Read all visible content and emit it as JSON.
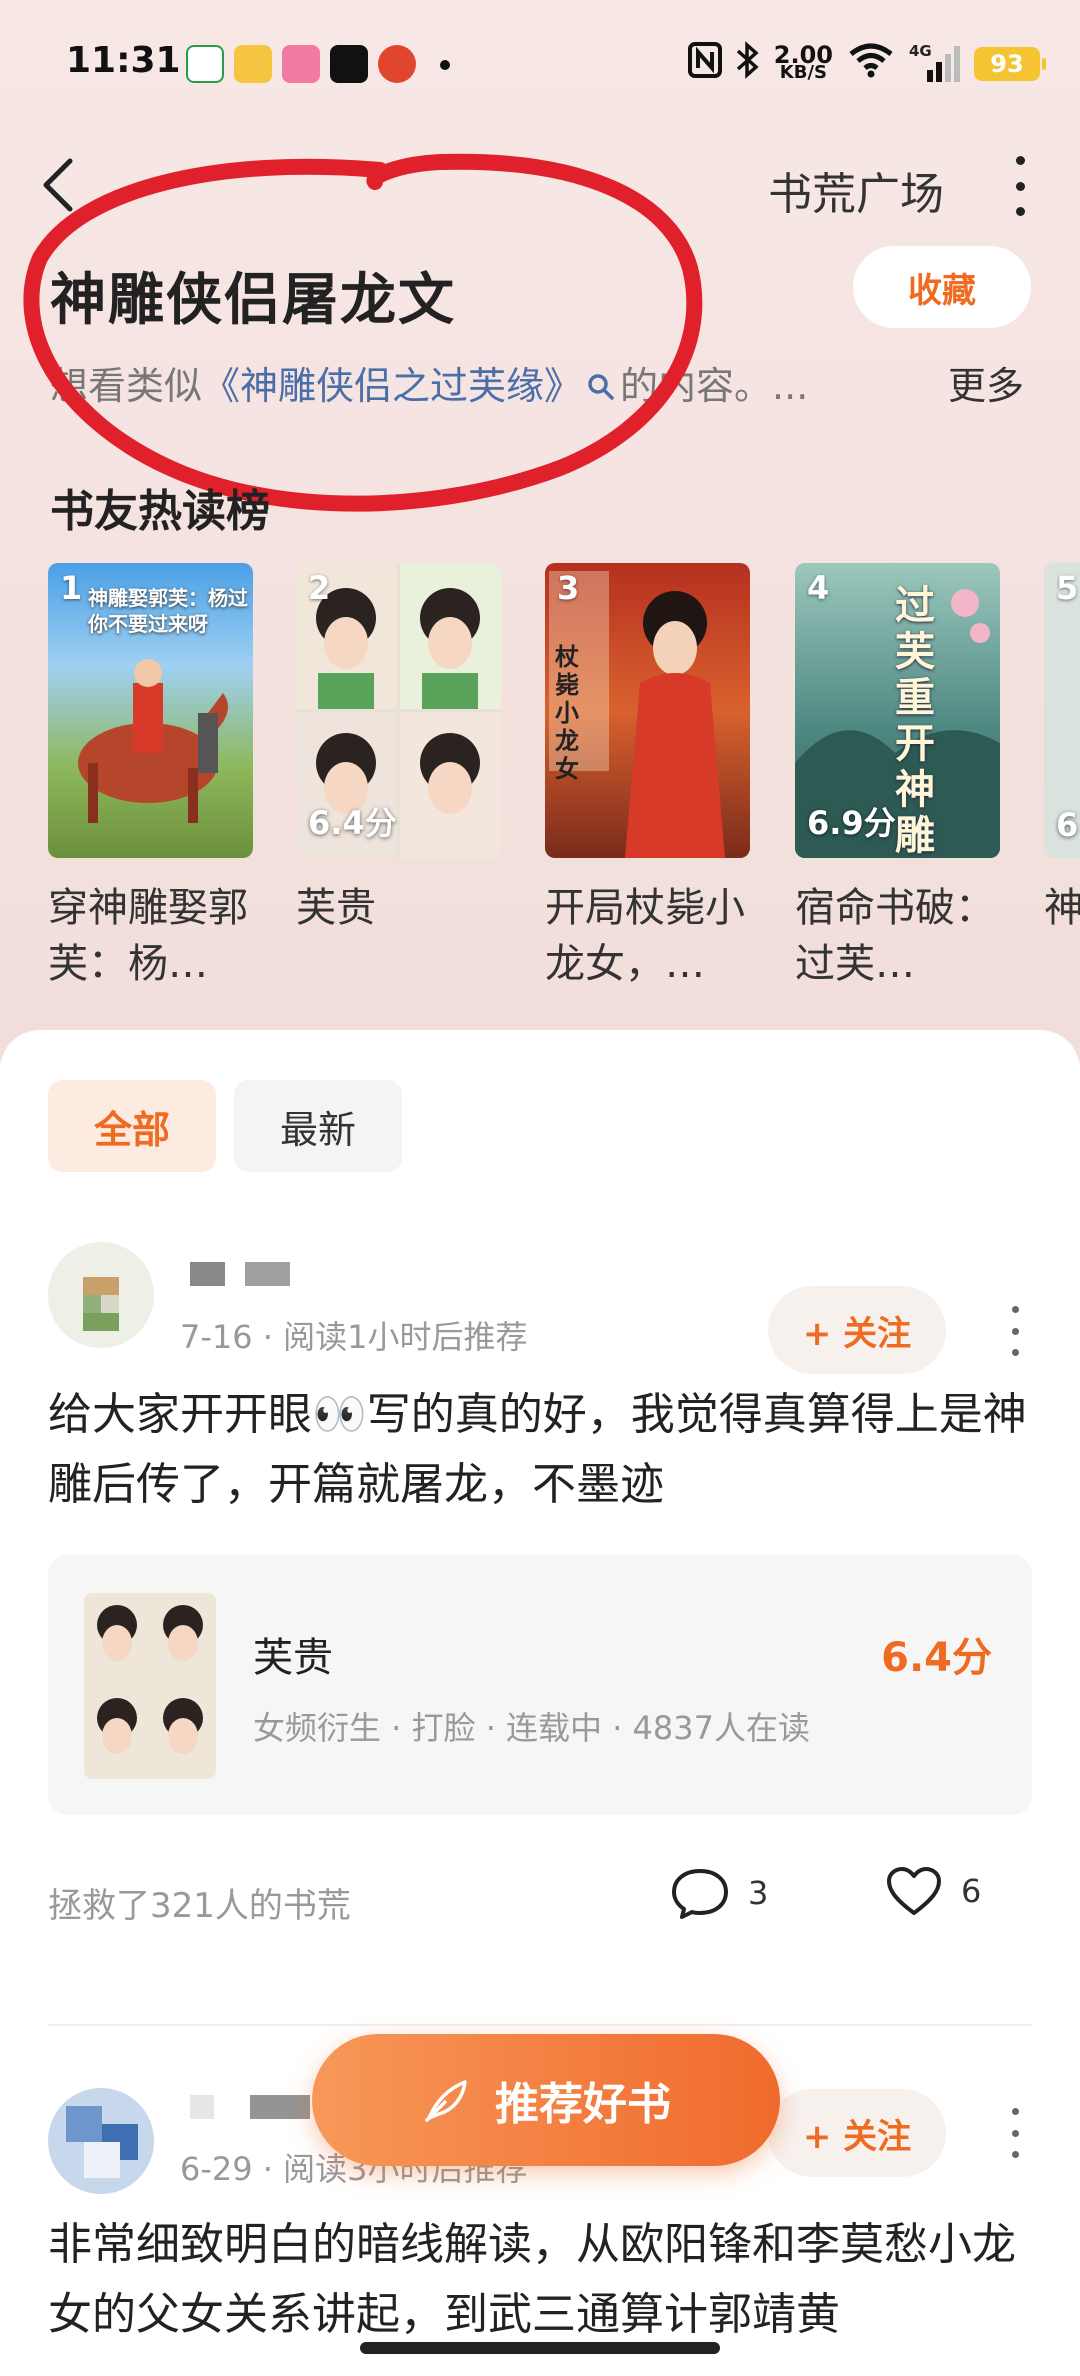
{
  "status_bar": {
    "time": "11:31",
    "net_speed_value": "2.00",
    "net_speed_unit": "KB/S",
    "network": "4G",
    "battery": "93",
    "icons": [
      "nfc-icon",
      "bluetooth-icon",
      "wifi-icon",
      "signal-icon"
    ]
  },
  "header": {
    "back_icon": "chevron-left-icon",
    "link": "书荒广场",
    "more_icon": "more-vertical-icon"
  },
  "topic": {
    "title": "神雕侠侣屠龙文",
    "favorite": "收藏",
    "subtitle_prefix": "想看类似",
    "subtitle_keyword": "《神雕侠侣之过芙缘》",
    "subtitle_suffix": "的内容。...",
    "more": "更多"
  },
  "ranking": {
    "title": "书友热读榜",
    "books": [
      {
        "rank": "1",
        "title": "穿神雕娶郭芙：杨…",
        "score": "",
        "cover_text": "神雕娶郭芙：杨过你不要过来呀"
      },
      {
        "rank": "2",
        "title": "芙贵",
        "score": "6.4分",
        "cover_text": ""
      },
      {
        "rank": "3",
        "title": "开局杖毙小龙女，…",
        "score": "",
        "cover_text": "杖毙小龙女"
      },
      {
        "rank": "4",
        "title": "宿命书破：过芙…",
        "score": "6.9分",
        "cover_text": "过芙重开神雕"
      },
      {
        "rank": "5",
        "title": "神录",
        "score": "6",
        "cover_text": ""
      }
    ]
  },
  "tabs": {
    "all": "全部",
    "latest": "最新"
  },
  "posts": [
    {
      "meta": "7-16 · 阅读1小时后推荐",
      "follow": "+ 关注",
      "text": "给大家开开眼👀写的真的好，我觉得真算得上是神雕后传了，开篇就屠龙，不墨迹",
      "book": {
        "title": "芙贵",
        "tags": "女频衍生 · 打脸 · 连载中 · 4837人在读",
        "score": "6.4分"
      },
      "saved": "拯救了321人的书荒",
      "comments": "3",
      "likes": "6"
    },
    {
      "meta": "6-29 · 阅读3小时后推荐",
      "follow": "+ 关注",
      "text": "非常细致明白的暗线解读，从欧阳锋和李莫愁小龙女的父女关系讲起，到武三通算计郭靖黄"
    }
  ],
  "recommend_button": "推荐好书",
  "colors": {
    "accent": "#ee6b21",
    "keyword": "#4a6fa8",
    "annotation": "#e0202a"
  }
}
